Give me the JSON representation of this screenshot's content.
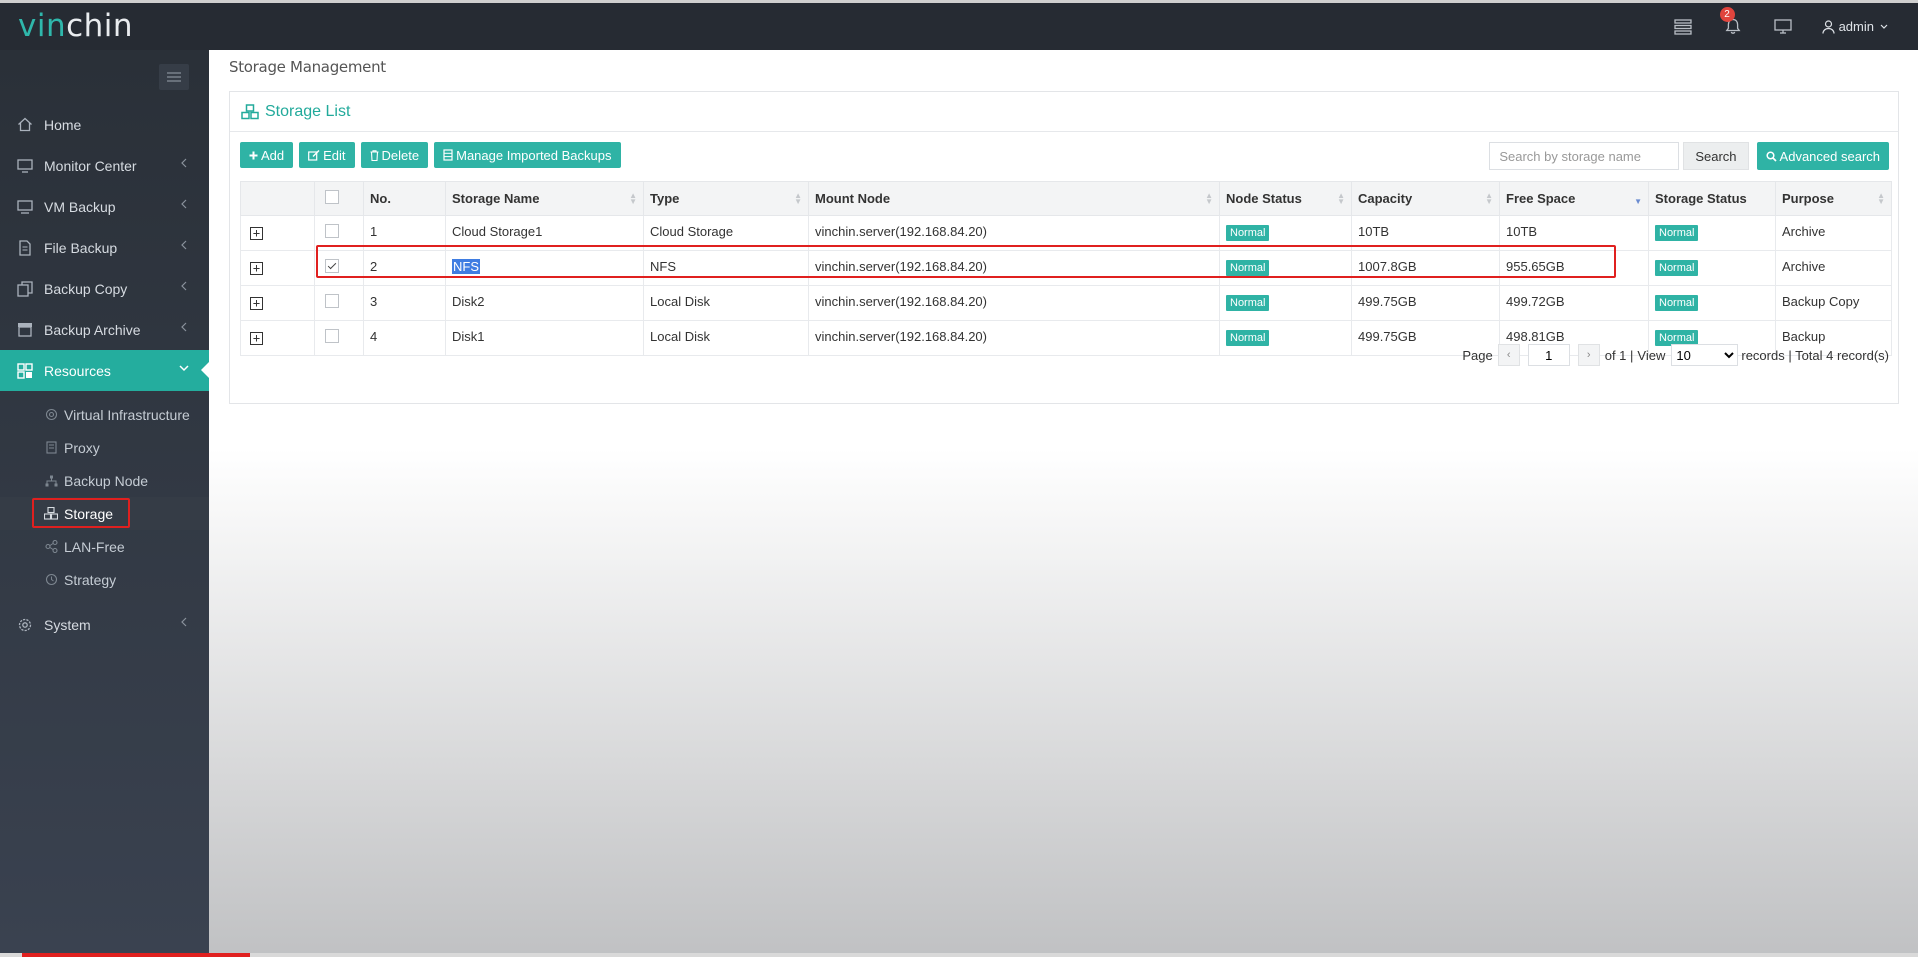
{
  "app": {
    "logo_part1": "vin",
    "logo_part2": "chin",
    "notification_count": "2",
    "user": "admin"
  },
  "sidebar": {
    "items": [
      {
        "label": "Home",
        "icon": "home-icon"
      },
      {
        "label": "Monitor Center",
        "icon": "monitor-icon"
      },
      {
        "label": "VM Backup",
        "icon": "vm-icon"
      },
      {
        "label": "File Backup",
        "icon": "file-icon"
      },
      {
        "label": "Backup Copy",
        "icon": "copy-icon"
      },
      {
        "label": "Backup Archive",
        "icon": "archive-icon"
      },
      {
        "label": "Resources",
        "icon": "resources-icon"
      },
      {
        "label": "System",
        "icon": "gear-icon"
      }
    ],
    "resources_sub": [
      {
        "label": "Virtual Infrastructure"
      },
      {
        "label": "Proxy"
      },
      {
        "label": "Backup Node"
      },
      {
        "label": "Storage"
      },
      {
        "label": "LAN-Free"
      },
      {
        "label": "Strategy"
      }
    ]
  },
  "page": {
    "title": "Storage Management",
    "panel_title": "Storage List"
  },
  "toolbar": {
    "add": "Add",
    "edit": "Edit",
    "delete": "Delete",
    "manage": "Manage Imported Backups"
  },
  "search": {
    "placeholder": "Search by storage name",
    "button": "Search",
    "advanced": "Advanced search"
  },
  "table": {
    "headers": [
      "No.",
      "Storage Name",
      "Type",
      "Mount Node",
      "Node Status",
      "Capacity",
      "Free Space",
      "Storage Status",
      "Purpose"
    ],
    "rows": [
      {
        "no": "1",
        "name": "Cloud Storage1",
        "type": "Cloud Storage",
        "mount": "vinchin.server(192.168.84.20)",
        "node_status": "Normal",
        "capacity": "10TB",
        "free": "10TB",
        "storage_status": "Normal",
        "purpose": "Archive",
        "checked": false
      },
      {
        "no": "2",
        "name": "NFS",
        "type": "NFS",
        "mount": "vinchin.server(192.168.84.20)",
        "node_status": "Normal",
        "capacity": "1007.8GB",
        "free": "955.65GB",
        "storage_status": "Normal",
        "purpose": "Archive",
        "checked": true
      },
      {
        "no": "3",
        "name": "Disk2",
        "type": "Local Disk",
        "mount": "vinchin.server(192.168.84.20)",
        "node_status": "Normal",
        "capacity": "499.75GB",
        "free": "499.72GB",
        "storage_status": "Normal",
        "purpose": "Backup Copy",
        "checked": false
      },
      {
        "no": "4",
        "name": "Disk1",
        "type": "Local Disk",
        "mount": "vinchin.server(192.168.84.20)",
        "node_status": "Normal",
        "capacity": "499.75GB",
        "free": "498.81GB",
        "storage_status": "Normal",
        "purpose": "Backup",
        "checked": false
      }
    ]
  },
  "pager": {
    "page_label": "Page",
    "page_value": "1",
    "of_label": "of 1 |",
    "view_label": "View",
    "view_value": "10",
    "records_label": "records | Total 4 record(s)"
  },
  "colors": {
    "accent": "#2fb3a5",
    "topbar": "#262b33",
    "highlight": "#e0201f"
  }
}
